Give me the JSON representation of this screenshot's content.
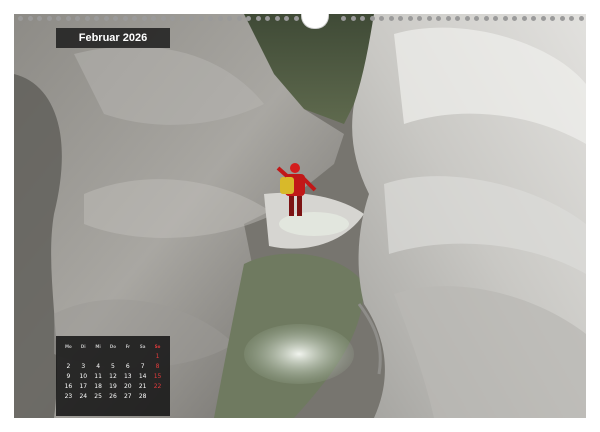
{
  "calendar": {
    "month_title": "Februar 2026",
    "weekday_headers": [
      "Mo",
      "Di",
      "Mi",
      "Do",
      "Fr",
      "Sa",
      "So"
    ],
    "weeks": [
      [
        "",
        "",
        "",
        "",
        "",
        "",
        "1"
      ],
      [
        "2",
        "3",
        "4",
        "5",
        "6",
        "7",
        "8"
      ],
      [
        "9",
        "10",
        "11",
        "12",
        "13",
        "14",
        "15"
      ],
      [
        "16",
        "17",
        "18",
        "19",
        "20",
        "21",
        "22"
      ],
      [
        "23",
        "24",
        "25",
        "26",
        "27",
        "28",
        ""
      ]
    ]
  },
  "colors": {
    "title_bar": "#191919",
    "sunday": "#e23b3b",
    "day_text": "#ffffff",
    "binding_holes": "#9a9a9a"
  },
  "photo": {
    "subject": "canyoneer-figure",
    "icons": [
      "wire-binding-icon",
      "hanger-icon"
    ]
  }
}
